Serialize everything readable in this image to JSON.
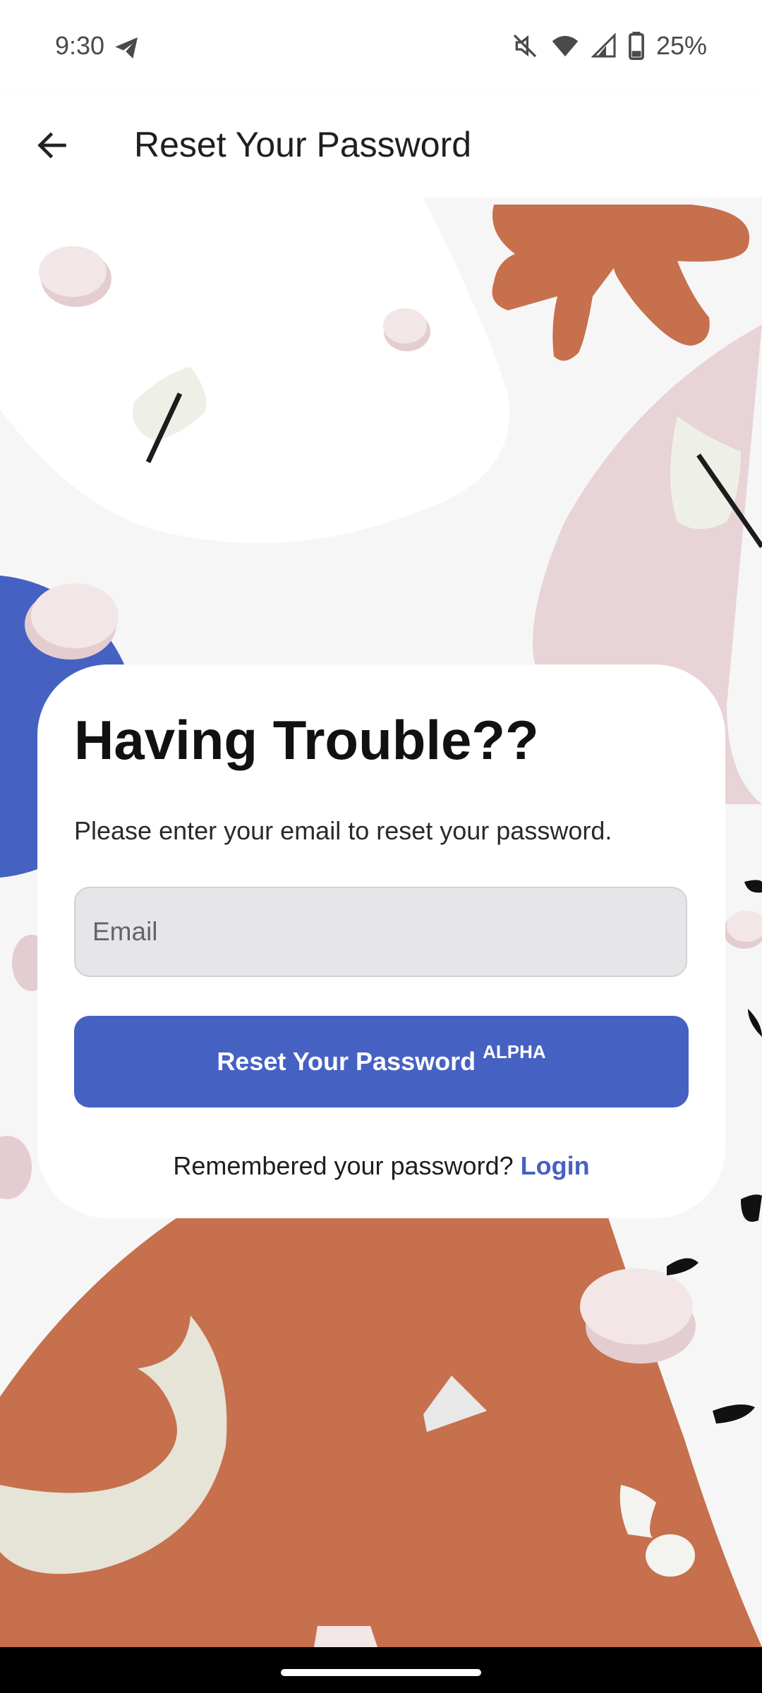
{
  "status_bar": {
    "time": "9:30",
    "battery": "25%",
    "icons": [
      "telegram-icon",
      "mute-icon",
      "wifi-icon",
      "signal-icon",
      "battery-icon"
    ]
  },
  "app_bar": {
    "title": "Reset Your Password",
    "back_icon": "arrow-back-icon"
  },
  "card": {
    "title": "Having Trouble??",
    "subtitle": "Please enter your email to reset your password.",
    "email": {
      "placeholder": "Email",
      "value": ""
    },
    "reset_button": {
      "label": "Reset Your Password",
      "badge": "ALPHA"
    },
    "login_prompt": "Remembered your password?",
    "login_link": "Login"
  },
  "colors": {
    "accent_blue": "#4561c1",
    "terracotta": "#c6704d",
    "pink": "#e8d3d6",
    "background": "#f6f6f6"
  }
}
